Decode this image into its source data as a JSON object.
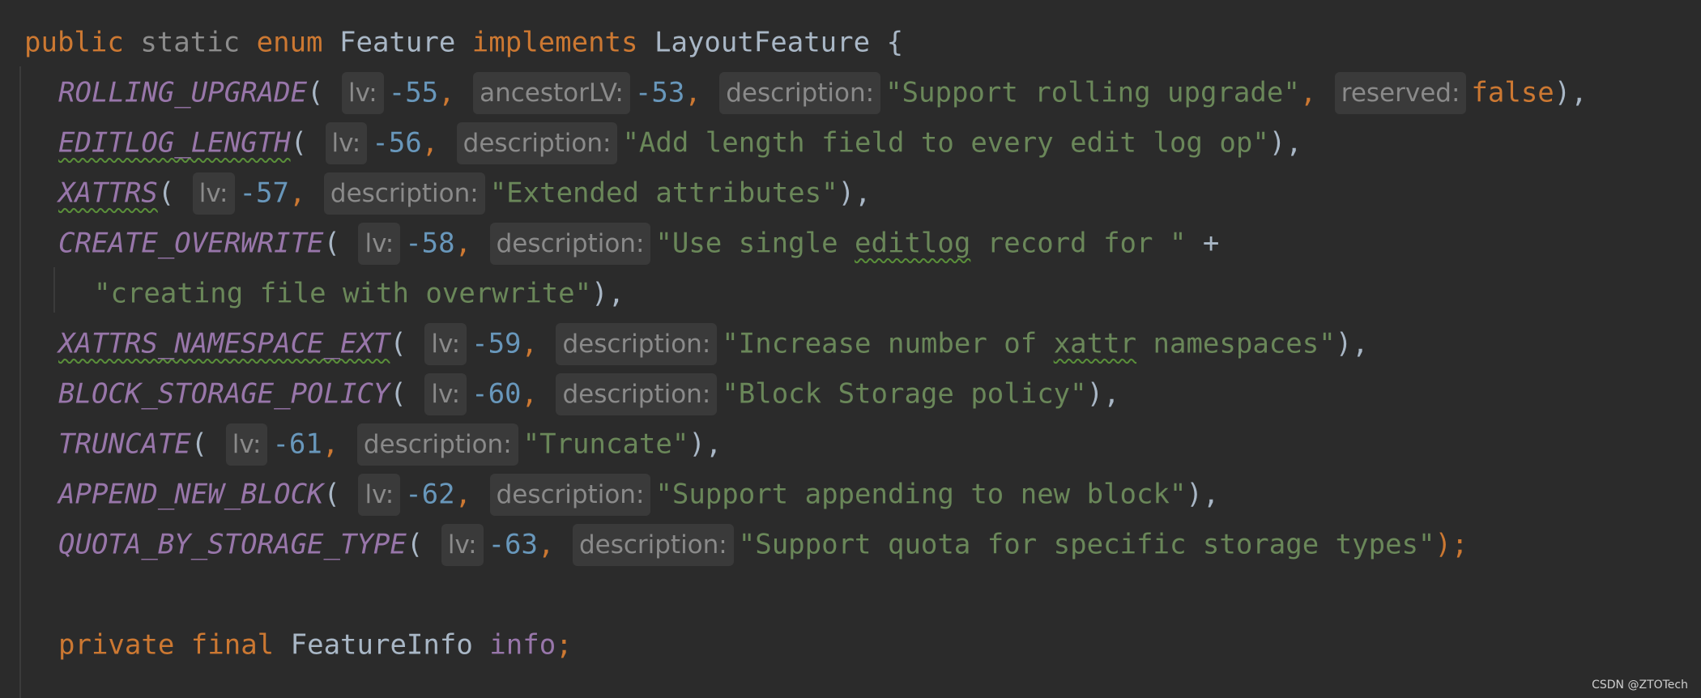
{
  "code": {
    "header": {
      "public": "public",
      "static": "static",
      "enum": "enum",
      "name": "Feature",
      "implements": "implements",
      "iface": "LayoutFeature",
      "brace": "{"
    },
    "hints": {
      "lv": "lv:",
      "ancestorLV": "ancestorLV:",
      "description": "description:",
      "reserved": "reserved:"
    },
    "entries": [
      {
        "name": "ROLLING_UPGRADE",
        "lv": "-55",
        "ancestor": "-53",
        "desc": "\"Support rolling upgrade\"",
        "reserved": "false",
        "end": "),"
      },
      {
        "name": "EDITLOG_LENGTH",
        "lv": "-56",
        "desc": "\"Add length field to every edit log op\"",
        "end": "),"
      },
      {
        "name": "XATTRS",
        "lv": "-57",
        "desc": "\"Extended attributes\"",
        "end": "),"
      },
      {
        "name": "CREATE_OVERWRITE",
        "lv": "-58",
        "desc_a": "\"Use single ",
        "desc_typo": "editlog",
        "desc_b": " record for \"",
        "plus": "+",
        "desc2": "\"creating file with overwrite\"",
        "end": "),"
      },
      {
        "name": "XATTRS_NAMESPACE_EXT",
        "lv": "-59",
        "desc_a": "\"Increase number of ",
        "desc_typo": "xattr",
        "desc_b": " namespaces\"",
        "end": "),"
      },
      {
        "name": "BLOCK_STORAGE_POLICY",
        "lv": "-60",
        "desc": "\"Block Storage policy\"",
        "end": "),"
      },
      {
        "name": "TRUNCATE",
        "lv": "-61",
        "desc": "\"Truncate\"",
        "end": "),"
      },
      {
        "name": "APPEND_NEW_BLOCK",
        "lv": "-62",
        "desc": "\"Support appending to new block\"",
        "end": "),"
      },
      {
        "name": "QUOTA_BY_STORAGE_TYPE",
        "lv": "-63",
        "desc": "\"Support quota for specific storage types\"",
        "end": ");"
      }
    ],
    "field_decl": {
      "private": "private",
      "final": "final",
      "type": "FeatureInfo",
      "name": "info",
      "semi": ";"
    }
  },
  "watermark": "CSDN @ZTOTech"
}
